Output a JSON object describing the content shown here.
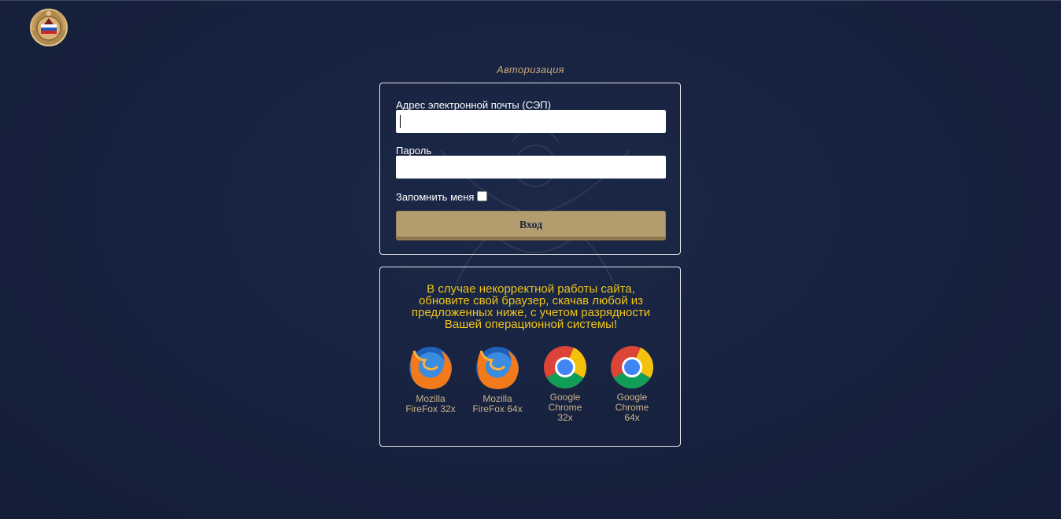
{
  "header": {
    "logo_icon": "traffic-police-emblem-icon"
  },
  "auth": {
    "title": "Авторизация",
    "email_label": "Адрес электронной почты (СЭП)",
    "email_value": "",
    "password_label": "Пароль",
    "password_value": "",
    "remember_label": "Запомнить меня",
    "remember_checked": false,
    "login_button": "Вход"
  },
  "info": {
    "message_lines": [
      "В случае некорректной работы сайта,",
      "обновите свой браузер, скачав любой из",
      "предложенных ниже, с учетом разрядности",
      "Вашей операционной системы!"
    ],
    "browsers": [
      {
        "label_lines": [
          "Mozilla",
          "FireFox 32x"
        ],
        "icon": "firefox-icon"
      },
      {
        "label_lines": [
          "Mozilla",
          "FireFox 64x"
        ],
        "icon": "firefox-icon"
      },
      {
        "label_lines": [
          "Google",
          "Chrome",
          "32x"
        ],
        "icon": "chrome-icon"
      },
      {
        "label_lines": [
          "Google",
          "Chrome",
          "64x"
        ],
        "icon": "chrome-icon"
      }
    ]
  },
  "colors": {
    "background": "#16213d",
    "accent_gold": "#b39c6d",
    "title_color": "#c9a877",
    "warning_text": "#f0c419"
  }
}
